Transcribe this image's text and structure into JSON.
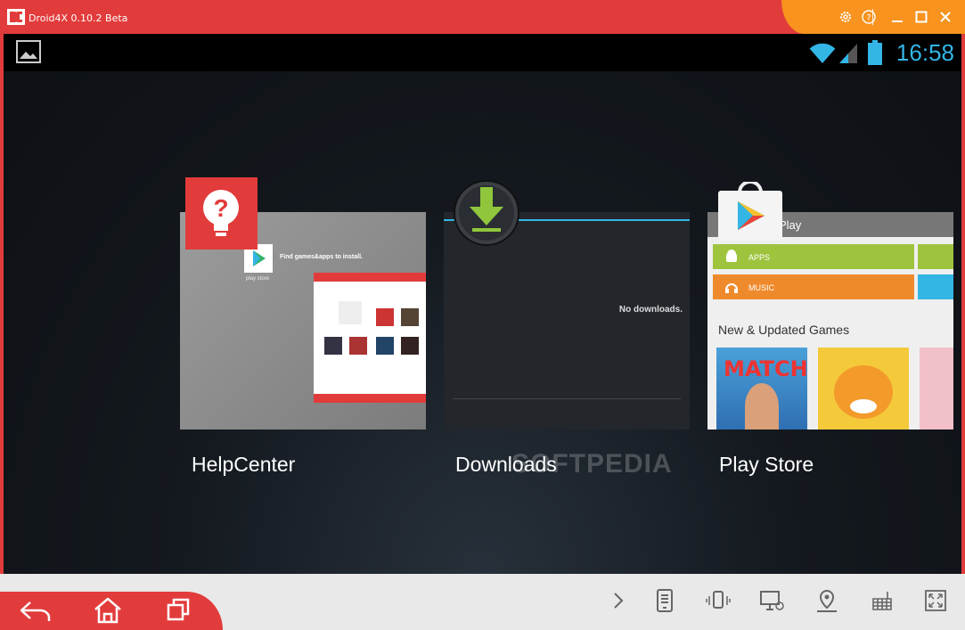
{
  "window": {
    "title": "Droid4X 0.10.2 Beta"
  },
  "title_controls": [
    "gear-icon",
    "help-icon",
    "minimize-icon",
    "maximize-icon",
    "close-icon"
  ],
  "statusbar": {
    "time": "16:58",
    "icons": [
      "gallery-icon",
      "wifi-icon",
      "signal-icon",
      "battery-icon"
    ]
  },
  "recents": [
    {
      "label": "HelpCenter",
      "thumb_text": "Find games&apps to install.",
      "thumb_icon_label": "play store"
    },
    {
      "label": "Downloads",
      "thumb_text": "No downloads."
    },
    {
      "label": "Play Store",
      "header": "Play",
      "tiles": [
        "APPS",
        "MUSIC"
      ],
      "section": "New & Updated Games",
      "game_title": "MATCH"
    }
  ],
  "watermark": "SOFTPEDIA",
  "colors": {
    "accent": "#e23b3b",
    "orange": "#f7931e",
    "android_blue": "#33b5e5",
    "apps_green": "#9ec43e",
    "music_orange": "#ef8a2c"
  },
  "nav_buttons": [
    "back-icon",
    "home-icon",
    "recent-apps-icon"
  ],
  "toolbar_icons": [
    "chevron-right-icon",
    "phone-icon",
    "shake-icon",
    "screen-share-icon",
    "location-icon",
    "keyboard-icon",
    "fullscreen-icon"
  ]
}
